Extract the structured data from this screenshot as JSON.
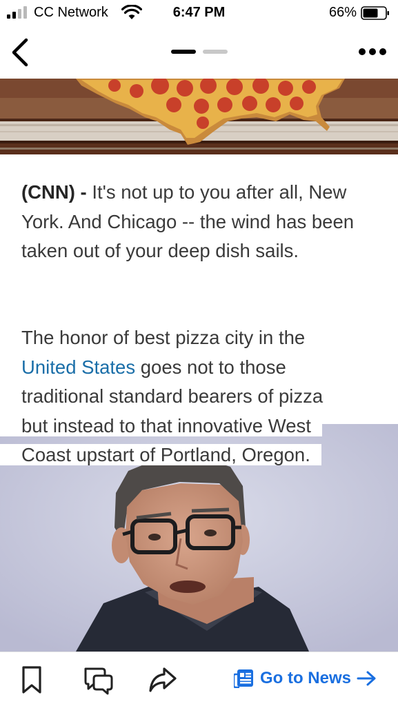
{
  "status_bar": {
    "carrier": "CC Network",
    "time": "6:47 PM",
    "battery": "66%"
  },
  "nav": {
    "back_icon": "chevron-left-icon",
    "more_icon": "ellipsis-icon",
    "page_indicator": {
      "count": 2,
      "active_index": 0
    }
  },
  "article": {
    "paragraph1_source": "(CNN) -",
    "paragraph1_text": " It's not up to you after all, New York. And Chicago -- the wind has been taken out of your deep dish sails.",
    "p2_line1": "The honor of best pizza city in the",
    "p2_link": "United States",
    "p2_line2_rest": " goes not to those",
    "p2_line3": "traditional standard bearers of pizza",
    "p2_line4": "but instead to that innovative West",
    "p2_line5": "Coast upstart of Portland, Oregon."
  },
  "toolbar": {
    "bookmark_icon": "bookmark-icon",
    "comment_icon": "comment-icon",
    "share_icon": "share-icon",
    "go_to_news_label": "Go to News"
  },
  "colors": {
    "link": "#1a6ea8",
    "accent": "#1a6fe0",
    "text": "#3a3a3a"
  }
}
